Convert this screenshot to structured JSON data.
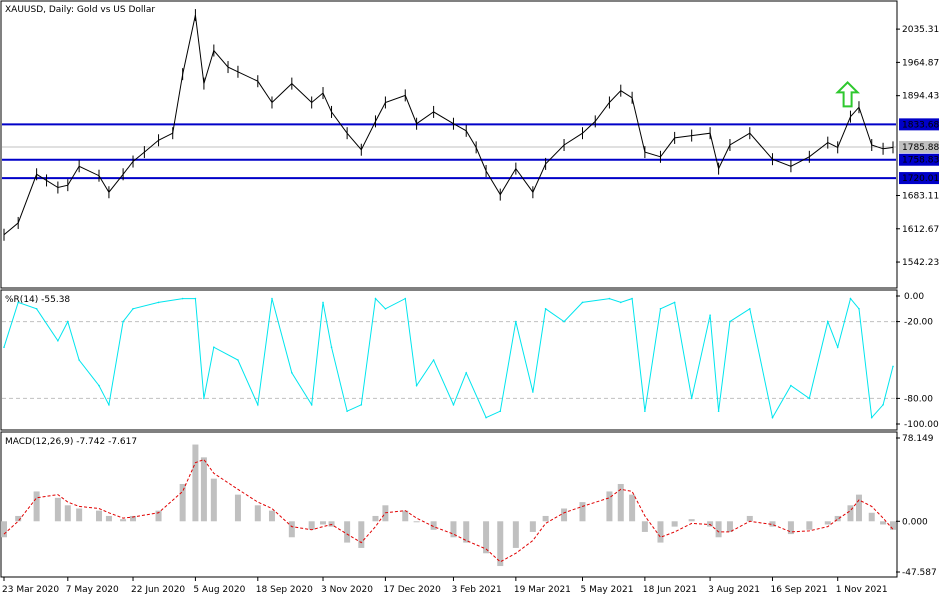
{
  "chart_data": [
    {
      "type": "line",
      "panel": "price",
      "title": "XAUUSD, Daily:  Gold vs US Dollar",
      "candles": [
        {
          "x": "23 Mar 2020",
          "y": 1600
        },
        {
          "x": "2 Apr 2020",
          "y": 1625
        },
        {
          "x": "15 Apr 2020",
          "y": 1728
        },
        {
          "x": "22 Apr 2020",
          "y": 1715
        },
        {
          "x": "30 Apr 2020",
          "y": 1700
        },
        {
          "x": "7 May 2020",
          "y": 1705
        },
        {
          "x": "15 May 2020",
          "y": 1745
        },
        {
          "x": "29 May 2020",
          "y": 1725
        },
        {
          "x": "5 Jun 2020",
          "y": 1690
        },
        {
          "x": "15 Jun 2020",
          "y": 1728
        },
        {
          "x": "22 Jun 2020",
          "y": 1755
        },
        {
          "x": "30 Jun 2020",
          "y": 1775
        },
        {
          "x": "10 Jul 2020",
          "y": 1800
        },
        {
          "x": "20 Jul 2020",
          "y": 1815
        },
        {
          "x": "27 Jul 2020",
          "y": 1940
        },
        {
          "x": "5 Aug 2020",
          "y": 2065
        },
        {
          "x": "11 Aug 2020",
          "y": 1920
        },
        {
          "x": "18 Aug 2020",
          "y": 1990
        },
        {
          "x": "28 Aug 2020",
          "y": 1955
        },
        {
          "x": "4 Sep 2020",
          "y": 1945
        },
        {
          "x": "18 Sep 2020",
          "y": 1925
        },
        {
          "x": "28 Sep 2020",
          "y": 1880
        },
        {
          "x": "12 Oct 2020",
          "y": 1920
        },
        {
          "x": "26 Oct 2020",
          "y": 1880
        },
        {
          "x": "3 Nov 2020",
          "y": 1900
        },
        {
          "x": "9 Nov 2020",
          "y": 1860
        },
        {
          "x": "20 Nov 2020",
          "y": 1815
        },
        {
          "x": "30 Nov 2020",
          "y": 1780
        },
        {
          "x": "10 Dec 2020",
          "y": 1840
        },
        {
          "x": "17 Dec 2020",
          "y": 1880
        },
        {
          "x": "31 Dec 2020",
          "y": 1895
        },
        {
          "x": "8 Jan 2021",
          "y": 1835
        },
        {
          "x": "20 Jan 2021",
          "y": 1860
        },
        {
          "x": "3 Feb 2021",
          "y": 1835
        },
        {
          "x": "12 Feb 2021",
          "y": 1820
        },
        {
          "x": "19 Feb 2021",
          "y": 1785
        },
        {
          "x": "26 Feb 2021",
          "y": 1735
        },
        {
          "x": "8 Mar 2021",
          "y": 1685
        },
        {
          "x": "19 Mar 2021",
          "y": 1740
        },
        {
          "x": "31 Mar 2021",
          "y": 1690
        },
        {
          "x": "9 Apr 2021",
          "y": 1750
        },
        {
          "x": "22 Apr 2021",
          "y": 1790
        },
        {
          "x": "5 May 2021",
          "y": 1815
        },
        {
          "x": "14 May 2021",
          "y": 1840
        },
        {
          "x": "24 May 2021",
          "y": 1880
        },
        {
          "x": "1 Jun 2021",
          "y": 1905
        },
        {
          "x": "9 Jun 2021",
          "y": 1890
        },
        {
          "x": "18 Jun 2021",
          "y": 1775
        },
        {
          "x": "29 Jun 2021",
          "y": 1765
        },
        {
          "x": "9 Jul 2021",
          "y": 1805
        },
        {
          "x": "21 Jul 2021",
          "y": 1810
        },
        {
          "x": "3 Aug 2021",
          "y": 1815
        },
        {
          "x": "9 Aug 2021",
          "y": 1740
        },
        {
          "x": "17 Aug 2021",
          "y": 1790
        },
        {
          "x": "31 Aug 2021",
          "y": 1815
        },
        {
          "x": "16 Sep 2021",
          "y": 1760
        },
        {
          "x": "29 Sep 2021",
          "y": 1745
        },
        {
          "x": "12 Oct 2021",
          "y": 1765
        },
        {
          "x": "25 Oct 2021",
          "y": 1795
        },
        {
          "x": "1 Nov 2021",
          "y": 1785
        },
        {
          "x": "10 Nov 2021",
          "y": 1850
        },
        {
          "x": "16 Nov 2021",
          "y": 1870
        },
        {
          "x": "25 Nov 2021",
          "y": 1790
        },
        {
          "x": "3 Dec 2021",
          "y": 1782
        },
        {
          "x": "10 Dec 2021",
          "y": 1785
        }
      ],
      "levels": [
        {
          "label": "1833.68",
          "value": 1833.68,
          "color": "#0000c8"
        },
        {
          "label": "1758.83",
          "value": 1758.83,
          "color": "#0000c8"
        },
        {
          "label": "1720.01",
          "value": 1720.01,
          "color": "#0000c8"
        }
      ],
      "current_price": {
        "label": "1785.88",
        "value": 1785.88
      },
      "y_ticks": [
        "2035.31",
        "1964.87",
        "1894.43",
        "1683.11",
        "1612.67",
        "1542.23"
      ],
      "annotation": {
        "type": "up-arrow",
        "x": "8 Nov 2021",
        "y": 1895,
        "color": "#2ec82e"
      }
    },
    {
      "type": "line",
      "panel": "williams-r",
      "title": "%R(14) -55.38",
      "ylim": [
        -100,
        0
      ],
      "reference_lines": [
        -20,
        -80
      ],
      "y_ticks": [
        "0.00",
        "-20.00",
        "-80.00",
        "-100.00"
      ],
      "series": [
        {
          "color": "#00e5ee",
          "x": [
            "23 Mar 2020",
            "2 Apr 2020",
            "15 Apr 2020",
            "30 Apr 2020",
            "7 May 2020",
            "15 May 2020",
            "29 May 2020",
            "5 Jun 2020",
            "15 Jun 2020",
            "22 Jun 2020",
            "10 Jul 2020",
            "27 Jul 2020",
            "5 Aug 2020",
            "11 Aug 2020",
            "18 Aug 2020",
            "4 Sep 2020",
            "18 Sep 2020",
            "28 Sep 2020",
            "12 Oct 2020",
            "26 Oct 2020",
            "3 Nov 2020",
            "9 Nov 2020",
            "20 Nov 2020",
            "30 Nov 2020",
            "10 Dec 2020",
            "17 Dec 2020",
            "31 Dec 2020",
            "8 Jan 2021",
            "20 Jan 2021",
            "3 Feb 2021",
            "12 Feb 2021",
            "26 Feb 2021",
            "8 Mar 2021",
            "19 Mar 2021",
            "31 Mar 2021",
            "9 Apr 2021",
            "22 Apr 2021",
            "5 May 2021",
            "24 May 2021",
            "1 Jun 2021",
            "9 Jun 2021",
            "18 Jun 2021",
            "29 Jun 2021",
            "9 Jul 2021",
            "21 Jul 2021",
            "3 Aug 2021",
            "9 Aug 2021",
            "17 Aug 2021",
            "31 Aug 2021",
            "16 Sep 2021",
            "29 Sep 2021",
            "12 Oct 2021",
            "25 Oct 2021",
            "1 Nov 2021",
            "10 Nov 2021",
            "16 Nov 2021",
            "25 Nov 2021",
            "3 Dec 2021",
            "10 Dec 2021"
          ],
          "values": [
            -40,
            -5,
            -10,
            -35,
            -20,
            -50,
            -70,
            -85,
            -20,
            -10,
            -5,
            -2,
            -2,
            -80,
            -40,
            -50,
            -85,
            -2,
            -60,
            -85,
            -5,
            -40,
            -90,
            -85,
            -2,
            -10,
            -2,
            -70,
            -50,
            -85,
            -60,
            -95,
            -90,
            -20,
            -75,
            -10,
            -20,
            -5,
            -2,
            -5,
            -2,
            -90,
            -10,
            -5,
            -80,
            -15,
            -90,
            -20,
            -10,
            -95,
            -70,
            -80,
            -20,
            -40,
            -2,
            -10,
            -95,
            -85,
            -55
          ]
        }
      ]
    },
    {
      "type": "bar",
      "panel": "macd",
      "title": "MACD(12,26,9) -7.742 -7.617",
      "ylim": [
        -47.587,
        78.149
      ],
      "y_ticks": [
        "78.149",
        "0.000",
        "-47.587"
      ],
      "x": [
        "23 Mar 2020",
        "2 Apr 2020",
        "15 Apr 2020",
        "30 Apr 2020",
        "7 May 2020",
        "15 May 2020",
        "29 May 2020",
        "5 Jun 2020",
        "15 Jun 2020",
        "22 Jun 2020",
        "10 Jul 2020",
        "27 Jul 2020",
        "5 Aug 2020",
        "11 Aug 2020",
        "18 Aug 2020",
        "4 Sep 2020",
        "18 Sep 2020",
        "28 Sep 2020",
        "12 Oct 2020",
        "26 Oct 2020",
        "3 Nov 2020",
        "9 Nov 2020",
        "20 Nov 2020",
        "30 Nov 2020",
        "10 Dec 2020",
        "17 Dec 2020",
        "31 Dec 2020",
        "8 Jan 2021",
        "20 Jan 2021",
        "3 Feb 2021",
        "12 Feb 2021",
        "26 Feb 2021",
        "8 Mar 2021",
        "19 Mar 2021",
        "31 Mar 2021",
        "9 Apr 2021",
        "22 Apr 2021",
        "5 May 2021",
        "24 May 2021",
        "1 Jun 2021",
        "9 Jun 2021",
        "18 Jun 2021",
        "29 Jun 2021",
        "9 Jul 2021",
        "21 Jul 2021",
        "3 Aug 2021",
        "9 Aug 2021",
        "17 Aug 2021",
        "31 Aug 2021",
        "16 Sep 2021",
        "29 Sep 2021",
        "12 Oct 2021",
        "25 Oct 2021",
        "1 Nov 2021",
        "10 Nov 2021",
        "16 Nov 2021",
        "25 Nov 2021",
        "3 Dec 2021",
        "10 Dec 2021"
      ],
      "series": [
        {
          "name": "histogram",
          "color": "#c0c0c0",
          "values": [
            -15,
            5,
            28,
            22,
            15,
            12,
            10,
            5,
            2,
            5,
            10,
            35,
            72,
            60,
            40,
            25,
            15,
            10,
            -15,
            -8,
            -3,
            -5,
            -20,
            -25,
            5,
            15,
            10,
            0,
            -8,
            -15,
            -20,
            -30,
            -42,
            -25,
            -10,
            5,
            12,
            18,
            28,
            35,
            25,
            -10,
            -20,
            -5,
            2,
            -5,
            -15,
            -10,
            5,
            -5,
            -12,
            -8,
            -3,
            5,
            15,
            25,
            8,
            -3,
            -8
          ]
        },
        {
          "name": "signal",
          "color": "#e00000",
          "values": [
            -12,
            0,
            22,
            25,
            18,
            14,
            12,
            8,
            3,
            4,
            8,
            28,
            55,
            58,
            45,
            30,
            18,
            12,
            -5,
            -8,
            -5,
            -3,
            -12,
            -20,
            -5,
            8,
            10,
            3,
            -5,
            -12,
            -18,
            -26,
            -38,
            -30,
            -18,
            -2,
            8,
            14,
            22,
            30,
            28,
            5,
            -15,
            -10,
            -2,
            -3,
            -10,
            -10,
            0,
            -3,
            -10,
            -9,
            -5,
            2,
            10,
            20,
            14,
            3,
            -7.6
          ]
        }
      ]
    }
  ],
  "x_axis": {
    "tick_labels": [
      "23 Mar 2020",
      "7 May 2020",
      "22 Jun 2020",
      "5 Aug 2020",
      "18 Sep 2020",
      "3 Nov 2020",
      "17 Dec 2020",
      "3 Feb 2021",
      "19 Mar 2021",
      "5 May 2021",
      "18 Jun 2021",
      "3 Aug 2021",
      "16 Sep 2021",
      "1 Nov 2021"
    ]
  },
  "colors": {
    "price_line": "#000000",
    "level_line": "#0000c8",
    "current_price_line": "#c0c0c0",
    "wr_line": "#00e5ee",
    "macd_hist": "#c0c0c0",
    "macd_signal": "#e00000",
    "arrow": "#2ec82e",
    "grid_dash": "#c0c0c0"
  }
}
